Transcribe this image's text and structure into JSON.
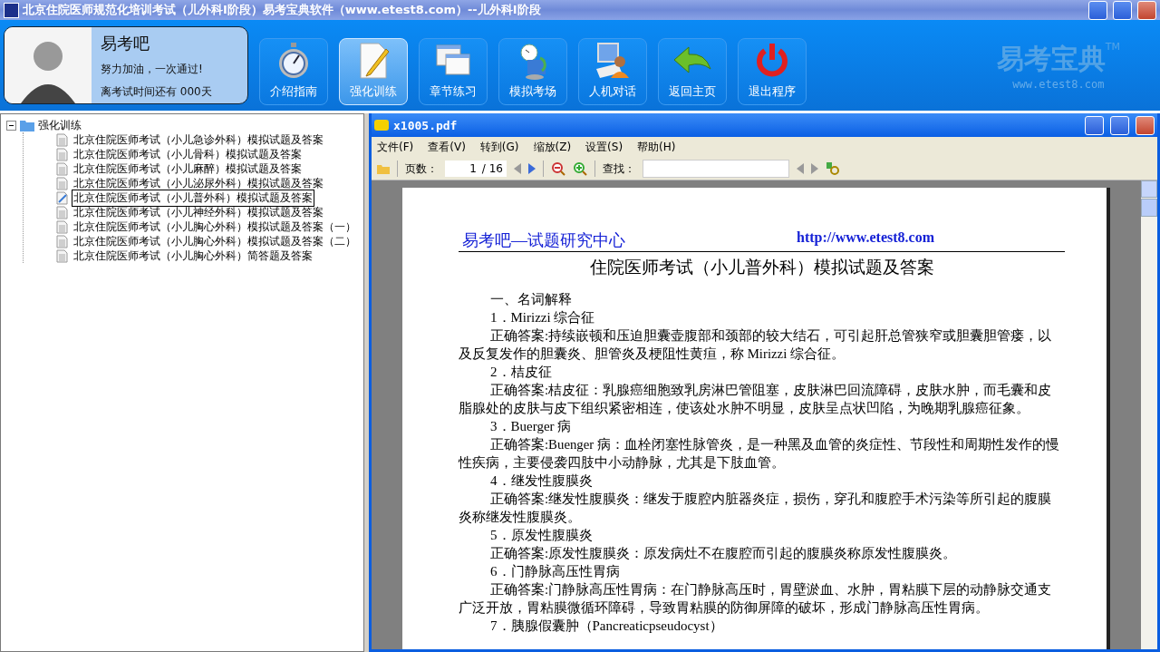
{
  "window": {
    "title": "北京住院医师规范化培训考试（儿外科Ⅰ阶段）易考宝典软件（www.etest8.com）--儿外科Ⅰ阶段"
  },
  "profile": {
    "name": "易考吧",
    "slogan": "努力加油，一次通过!",
    "countdown": "离考试时间还有 000天"
  },
  "nav_buttons": [
    {
      "kind": "stopwatch",
      "label": "介绍指南",
      "selected": false
    },
    {
      "kind": "document",
      "label": "强化训练",
      "selected": true
    },
    {
      "kind": "windows",
      "label": "章节练习",
      "selected": false
    },
    {
      "kind": "globe",
      "label": "模拟考场",
      "selected": false
    },
    {
      "kind": "person",
      "label": "人机对话",
      "selected": false
    },
    {
      "kind": "back",
      "label": "返回主页",
      "selected": false
    },
    {
      "kind": "power",
      "label": "退出程序",
      "selected": false
    }
  ],
  "logo": {
    "text": "易考宝典",
    "mark": "TM",
    "url": "www.etest8.com"
  },
  "tree": {
    "label": "强化训练",
    "expanded": true,
    "children": [
      {
        "label": "北京住院医师考试（小儿急诊外科）模拟试题及答案",
        "selected": false
      },
      {
        "label": "北京住院医师考试（小儿骨科）模拟试题及答案",
        "selected": false
      },
      {
        "label": "北京住院医师考试（小儿麻醉）模拟试题及答案",
        "selected": false
      },
      {
        "label": "北京住院医师考试（小儿泌尿外科）模拟试题及答案",
        "selected": false
      },
      {
        "label": "北京住院医师考试（小儿普外科）模拟试题及答案",
        "selected": true
      },
      {
        "label": "北京住院医师考试（小儿神经外科）模拟试题及答案",
        "selected": false
      },
      {
        "label": "北京住院医师考试（小儿胸心外科）模拟试题及答案（一）",
        "selected": false
      },
      {
        "label": "北京住院医师考试（小儿胸心外科）模拟试题及答案（二）",
        "selected": false
      },
      {
        "label": "北京住院医师考试（小儿胸心外科）简答题及答案",
        "selected": false
      }
    ]
  },
  "pdf_viewer": {
    "title": "x1005.pdf",
    "menu": [
      "文件(F)",
      "查看(V)",
      "转到(G)",
      "缩放(Z)",
      "设置(S)",
      "帮助(H)"
    ],
    "toolbar": {
      "page_label": "页数：",
      "page_value": "1",
      "page_total": "/ 16",
      "find_label": "查找："
    },
    "document": {
      "header_left": "易考吧—试题研究中心",
      "header_right": "http://www.etest8.com",
      "title": "住院医师考试（小儿普外科）模拟试题及答案",
      "blocks": [
        {
          "kind": "heading",
          "text": "一、名词解释"
        },
        {
          "kind": "heading",
          "text": "1．Mirizzi 综合征"
        },
        {
          "kind": "answer",
          "text": "正确答案:持续嵌顿和压迫胆囊壶腹部和颈部的较大结石，可引起肝总管狭窄或胆囊胆管瘘，以及反复发作的胆囊炎、胆管炎及梗阻性黄疸，称 Mirizzi 综合征。"
        },
        {
          "kind": "heading",
          "text": "2．桔皮征"
        },
        {
          "kind": "answer",
          "text": "正确答案:桔皮征：乳腺癌细胞致乳房淋巴管阻塞，皮肤淋巴回流障碍，皮肤水肿，而毛囊和皮脂腺处的皮肤与皮下组织紧密相连，使该处水肿不明显，皮肤呈点状凹陷，为晚期乳腺癌征象。"
        },
        {
          "kind": "heading",
          "text": "3．Buerger 病"
        },
        {
          "kind": "answer",
          "text": "正确答案:Buenger 病：血栓闭塞性脉管炎，是一种黑及血管的炎症性、节段性和周期性发作的慢性疾病，主要侵袭四肢中小动静脉，尤其是下肢血管。"
        },
        {
          "kind": "heading",
          "text": "4．继发性腹膜炎"
        },
        {
          "kind": "answer",
          "text": "正确答案:继发性腹膜炎：继发于腹腔内脏器炎症，损伤，穿孔和腹腔手术污染等所引起的腹膜炎称继发性腹膜炎。"
        },
        {
          "kind": "heading",
          "text": "5．原发性腹膜炎"
        },
        {
          "kind": "answer",
          "text": "正确答案:原发性腹膜炎：原发病灶不在腹腔而引起的腹膜炎称原发性腹膜炎。"
        },
        {
          "kind": "heading",
          "text": "6．门静脉高压性胃病"
        },
        {
          "kind": "answer",
          "text": "正确答案:门静脉高压性胃病：在门静脉高压时，胃壁淤血、水肿，胃粘膜下层的动静脉交通支广泛开放，胃粘膜微循环障碍，导致胃粘膜的防御屏障的破坏，形成门静脉高压性胃病。"
        },
        {
          "kind": "heading",
          "text": "7．胰腺假囊肿（Pancreaticpseudocyst）"
        }
      ]
    }
  }
}
